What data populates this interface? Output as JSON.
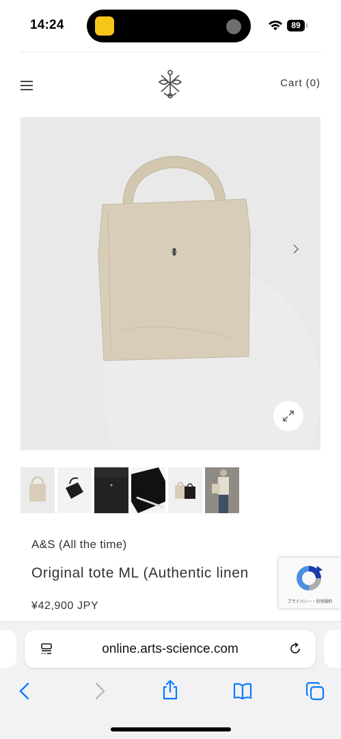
{
  "status_bar": {
    "time": "14:24",
    "battery": "89"
  },
  "header": {
    "cart_label": "Cart (0)",
    "menu_icon": "hamburger-icon",
    "logo_icon": "arts-science-crest-logo"
  },
  "gallery": {
    "thumbnail_count": 6,
    "selected_index": 0,
    "thumbnails": [
      "beige-tote",
      "black-tote-small",
      "black-tote-flat",
      "black-tote-angle",
      "beige-and-black-totes",
      "model-with-tote"
    ]
  },
  "product": {
    "brand": "A&S (All the time)",
    "title": "Original tote ML (Authentic linen",
    "price": "¥42,900  JPY"
  },
  "recaptcha": {
    "footer_text": "プライバシー・利用規約"
  },
  "browser": {
    "url": "online.arts-science.com",
    "icons": {
      "reader": "reader-mode-icon",
      "reload": "reload-icon",
      "back": "back-icon",
      "forward": "forward-icon",
      "share": "share-icon",
      "bookmarks": "bookmarks-icon",
      "tabs": "tabs-icon"
    }
  },
  "colors": {
    "accent_blue": "#0a7aff",
    "product_bg": "#e9e9ea",
    "linen": "#d8cdb8"
  }
}
